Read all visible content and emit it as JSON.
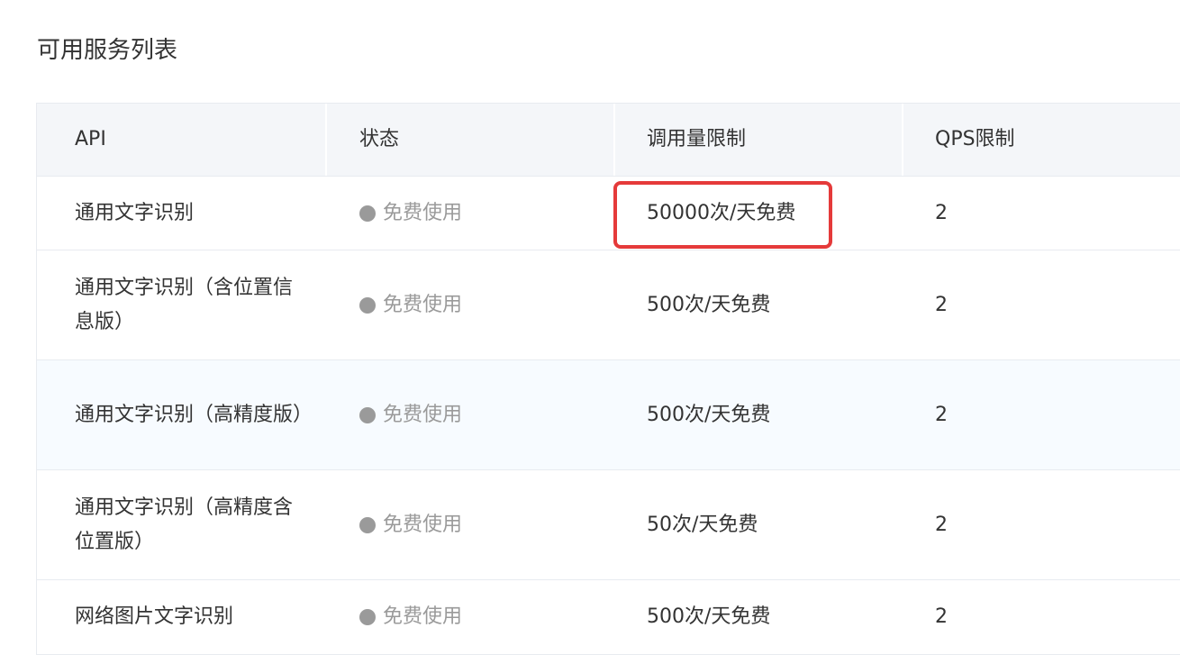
{
  "page": {
    "title": "可用服务列表"
  },
  "table": {
    "headers": {
      "api": "API",
      "status": "状态",
      "quota": "调用量限制",
      "qps": "QPS限制"
    },
    "rows": [
      {
        "api": "通用文字识别",
        "status": "免费使用",
        "quota": "50000次/天免费",
        "qps": "2"
      },
      {
        "api": "通用文字识别（含位置信息版）",
        "status": "免费使用",
        "quota": "500次/天免费",
        "qps": "2"
      },
      {
        "api": "通用文字识别（高精度版）",
        "status": "免费使用",
        "quota": "500次/天免费",
        "qps": "2"
      },
      {
        "api": "通用文字识别（高精度含位置版）",
        "status": "免费使用",
        "quota": "50次/天免费",
        "qps": "2"
      },
      {
        "api": "网络图片文字识别",
        "status": "免费使用",
        "quota": "500次/天免费",
        "qps": "2"
      }
    ]
  },
  "colors": {
    "highlight_border": "#e53a3a",
    "status_gray": "#9a9a9a",
    "header_bg": "#f4f6f9",
    "alt_row_bg": "#f7fbff"
  }
}
